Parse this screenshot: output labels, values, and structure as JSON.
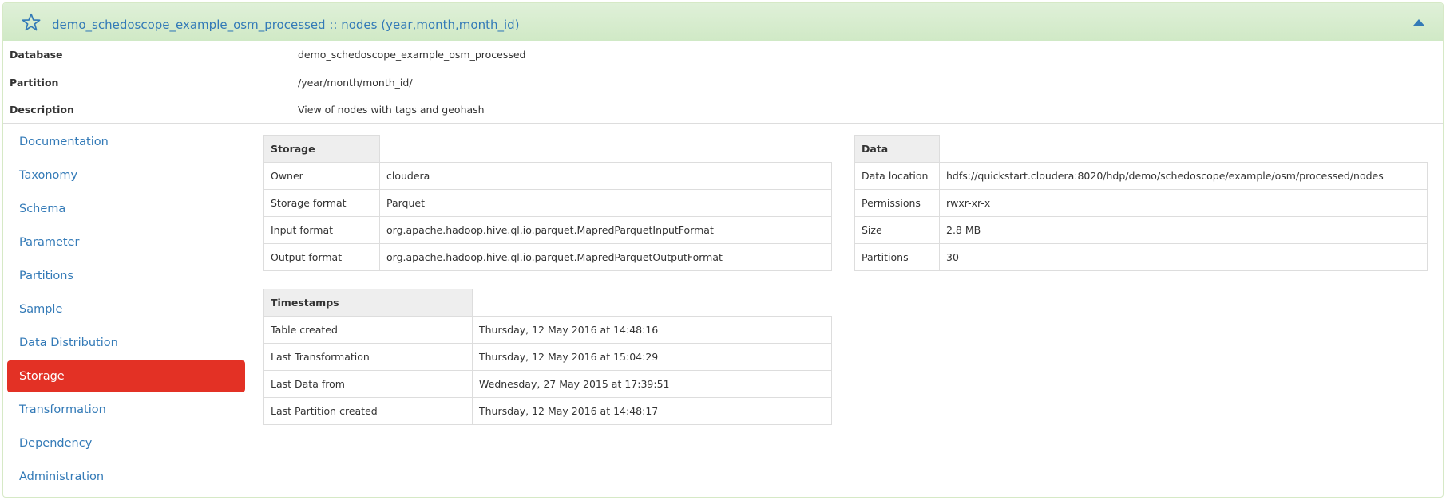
{
  "header": {
    "title": "demo_schedoscope_example_osm_processed :: nodes (year,month,month_id)",
    "star_icon": "star-icon",
    "collapse_icon": "caret-up-icon"
  },
  "info": {
    "rows": [
      {
        "key": "Database",
        "value": "demo_schedoscope_example_osm_processed"
      },
      {
        "key": "Partition",
        "value": "/year/month/month_id/"
      },
      {
        "key": "Description",
        "value": "View of nodes with tags and geohash"
      }
    ]
  },
  "sidebar": {
    "active_color": "#e33125",
    "link_color": "#337ab7",
    "items": [
      {
        "label": "Documentation"
      },
      {
        "label": "Taxonomy"
      },
      {
        "label": "Schema"
      },
      {
        "label": "Parameter"
      },
      {
        "label": "Partitions"
      },
      {
        "label": "Sample"
      },
      {
        "label": "Data Distribution"
      },
      {
        "label": "Storage"
      },
      {
        "label": "Transformation"
      },
      {
        "label": "Dependency"
      },
      {
        "label": "Administration"
      }
    ],
    "active": "Storage"
  },
  "storage": {
    "title": "Storage",
    "rows": [
      {
        "key": "Owner",
        "value": "cloudera"
      },
      {
        "key": "Storage format",
        "value": "Parquet"
      },
      {
        "key": "Input format",
        "value": "org.apache.hadoop.hive.ql.io.parquet.MapredParquetInputFormat"
      },
      {
        "key": "Output format",
        "value": "org.apache.hadoop.hive.ql.io.parquet.MapredParquetOutputFormat"
      }
    ]
  },
  "timestamps": {
    "title": "Timestamps",
    "rows": [
      {
        "key": "Table created",
        "value": "Thursday, 12 May 2016 at 14:48:16"
      },
      {
        "key": "Last Transformation",
        "value": "Thursday, 12 May 2016 at 15:04:29"
      },
      {
        "key": "Last Data from",
        "value": "Wednesday, 27 May 2015 at 17:39:51"
      },
      {
        "key": "Last Partition created",
        "value": "Thursday, 12 May 2016 at 14:48:17"
      }
    ]
  },
  "data": {
    "title": "Data",
    "rows": [
      {
        "key": "Data location",
        "value": "hdfs://quickstart.cloudera:8020/hdp/demo/schedoscope/example/osm/processed/nodes"
      },
      {
        "key": "Permissions",
        "value": "rwxr-xr-x"
      },
      {
        "key": "Size",
        "value": "2.8 MB"
      },
      {
        "key": "Partitions",
        "value": "30"
      }
    ]
  }
}
